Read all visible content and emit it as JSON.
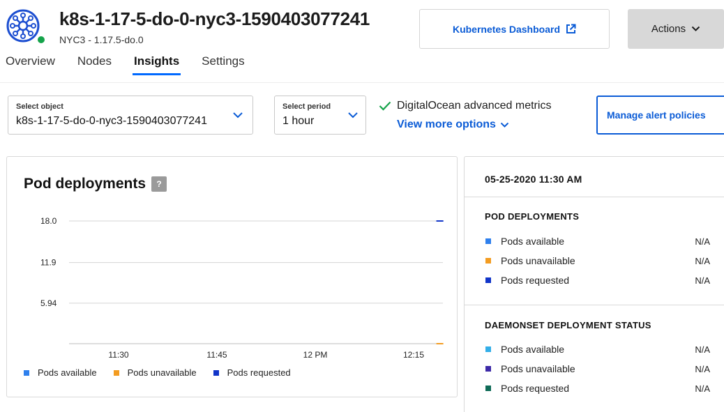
{
  "header": {
    "title": "k8s-1-17-5-do-0-nyc3-1590403077241",
    "subtitle": "NYC3 - 1.17.5-do.0",
    "status_color": "#15a34a",
    "icon": "kubernetes-icon",
    "dashboard_button": "Kubernetes Dashboard",
    "actions_button": "Actions"
  },
  "tabs": [
    {
      "label": "Overview",
      "active": false
    },
    {
      "label": "Nodes",
      "active": false
    },
    {
      "label": "Insights",
      "active": true
    },
    {
      "label": "Settings",
      "active": false
    }
  ],
  "filters": {
    "object_label": "Select object",
    "object_value": "k8s-1-17-5-do-0-nyc3-1590403077241",
    "period_label": "Select period",
    "period_value": "1 hour",
    "metrics_text": "DigitalOcean advanced metrics",
    "more_options": "View more options",
    "alert_button": "Manage alert policies"
  },
  "chart_panel": {
    "title": "Pod deployments",
    "help": "?"
  },
  "chart_data": {
    "type": "line",
    "x": [
      "11:30",
      "11:45",
      "12 PM",
      "12:15"
    ],
    "y_ticks": [
      "18.0",
      "11.9",
      "5.94"
    ],
    "ylim": [
      0,
      18.0
    ],
    "grid": true,
    "legend_position": "bottom",
    "series": [
      {
        "name": "Pods available",
        "color": "#2f80ed",
        "x": "12:19",
        "y": 18.0
      },
      {
        "name": "Pods unavailable",
        "color": "#f39c21",
        "x": "12:19",
        "y": 0
      },
      {
        "name": "Pods requested",
        "color": "#1135c9",
        "x": "12:19",
        "y": 18.0
      }
    ]
  },
  "side_panel": {
    "timestamp": "05-25-2020 11:30 AM",
    "sections": [
      {
        "heading": "POD DEPLOYMENTS",
        "rows": [
          {
            "label": "Pods available",
            "value": "N/A",
            "color": "#2f80ed"
          },
          {
            "label": "Pods unavailable",
            "value": "N/A",
            "color": "#f39c21"
          },
          {
            "label": "Pods requested",
            "value": "N/A",
            "color": "#1135c9"
          }
        ]
      },
      {
        "heading": "DAEMONSET DEPLOYMENT STATUS",
        "rows": [
          {
            "label": "Pods available",
            "value": "N/A",
            "color": "#33aee8"
          },
          {
            "label": "Pods unavailable",
            "value": "N/A",
            "color": "#3d2aa8"
          },
          {
            "label": "Pods requested",
            "value": "N/A",
            "color": "#0f6b57"
          }
        ]
      }
    ]
  }
}
